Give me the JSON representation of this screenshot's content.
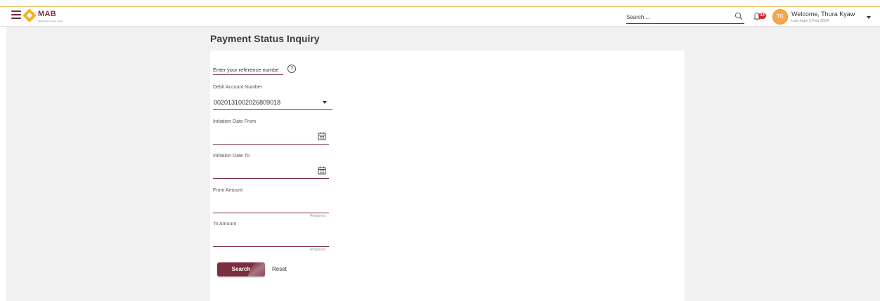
{
  "header": {
    "logo_text": "MAB",
    "logo_tagline": "Mega Bank Limited · Bank",
    "search_placeholder": "Search ...",
    "notification_count": "33",
    "avatar_initials": "TK",
    "welcome_text": "Welcome, Thura Kyaw",
    "last_login": "Last login 2 Feb 2024,"
  },
  "page": {
    "title": "Payment Status Inquiry"
  },
  "form": {
    "reference_placeholder": "Enter your reference numbe",
    "help_symbol": "?",
    "debit_account_label": "Debit Account Number",
    "debit_account_value": "0020131002026809018",
    "date_from_label": "Initiation Date From",
    "date_to_label": "Initiation Date To",
    "from_amount_label": "From Amount",
    "from_amount_hint": "Required",
    "to_amount_label": "To Amount",
    "to_amount_hint": "Required",
    "search_button": "Search",
    "reset_button": "Reset"
  },
  "colors": {
    "brand": "#7a2e3e",
    "accent": "#f4b128",
    "badge": "#d9262b"
  },
  "icons": [
    "hamburger-menu-icon",
    "logo-diamond-icon",
    "search-icon",
    "bell-icon",
    "help-icon",
    "calendar-icon",
    "chevron-down-icon"
  ]
}
